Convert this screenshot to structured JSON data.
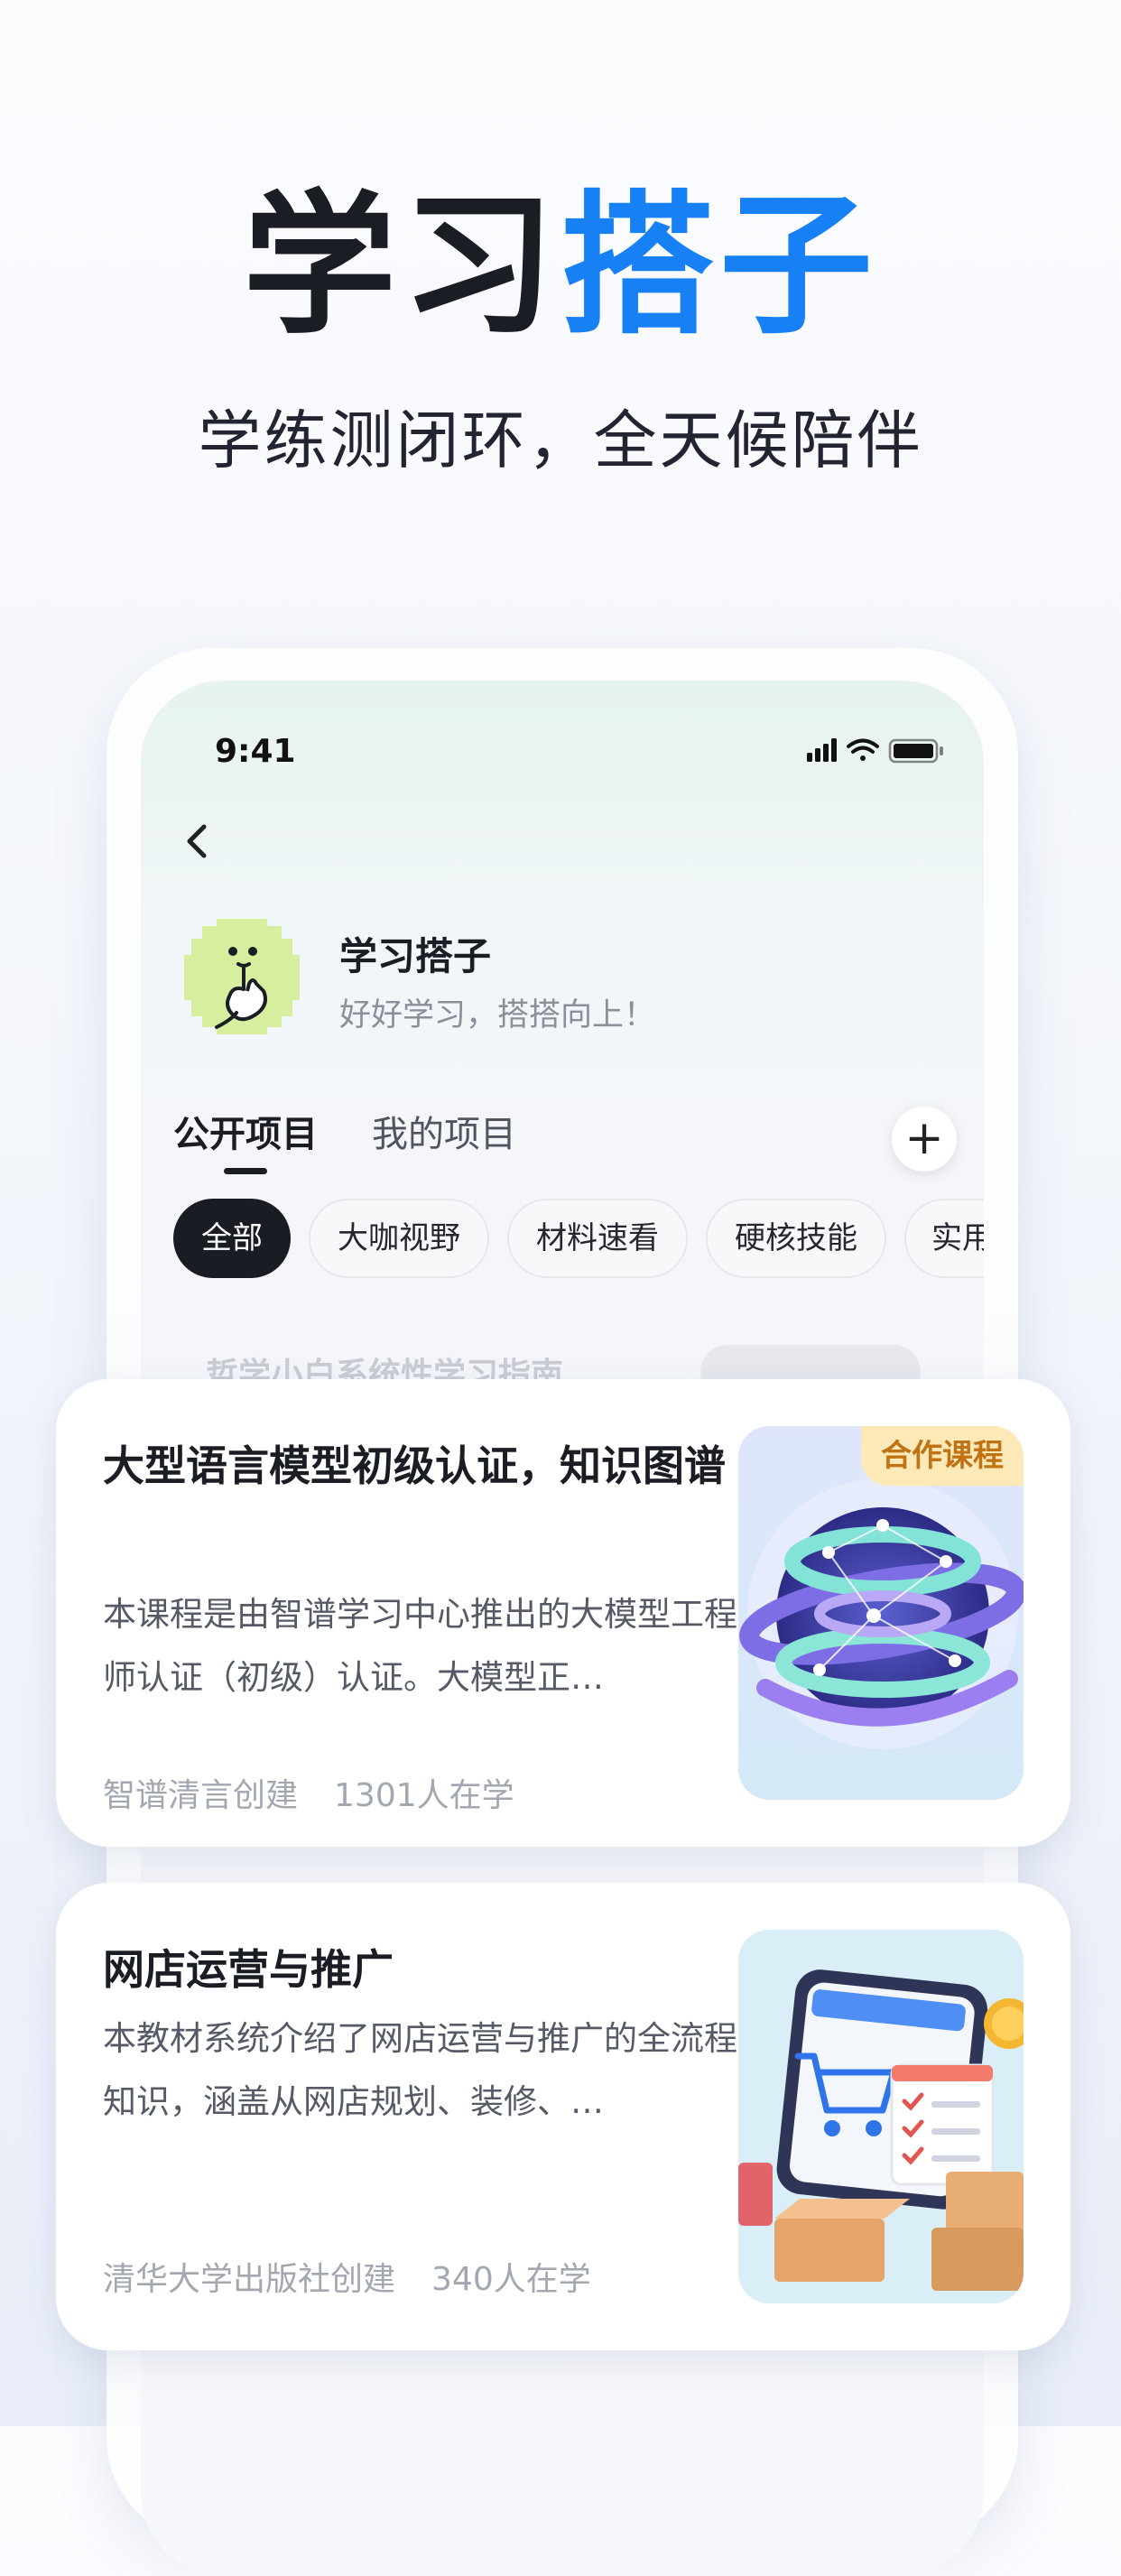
{
  "hero": {
    "title_dark": "学习",
    "title_blue": "搭子",
    "subtitle": "学练测闭环，全天候陪伴"
  },
  "status_bar": {
    "time": "9:41"
  },
  "profile": {
    "name": "学习搭子",
    "slogan": "好好学习，搭搭向上！"
  },
  "tabs": [
    {
      "label": "公开项目",
      "active": true
    },
    {
      "label": "我的项目",
      "active": false
    }
  ],
  "add_button": {
    "label": "+"
  },
  "chips": [
    {
      "label": "全部",
      "active": true
    },
    {
      "label": "大咖视野",
      "active": false
    },
    {
      "label": "材料速看",
      "active": false
    },
    {
      "label": "硬核技能",
      "active": false
    },
    {
      "label": "实用",
      "active": false
    }
  ],
  "background_item": {
    "title": "哲学小白系统性学习指南"
  },
  "cards": [
    {
      "title": "大型语言模型初级认证，知识图谱",
      "description": "本课程是由智谱学习中心推出的大模型工程师认证（初级）认证。大模型正…",
      "creator": "智谱清言创建",
      "learners": "1301人在学",
      "badge": "合作课程",
      "image_icon": "globe-network-illustration"
    },
    {
      "title": "网店运营与推广",
      "description": "本教材系统介绍了网店运营与推广的全流程知识，涵盖从网店规划、装修、…",
      "creator": "清华大学出版社创建",
      "learners": "340人在学",
      "image_icon": "online-shop-illustration"
    }
  ],
  "colors": {
    "accent_blue": "#1780f5",
    "badge_bg": "#fde9b8",
    "badge_text": "#c07314",
    "chip_active_bg": "#1a1c24"
  }
}
